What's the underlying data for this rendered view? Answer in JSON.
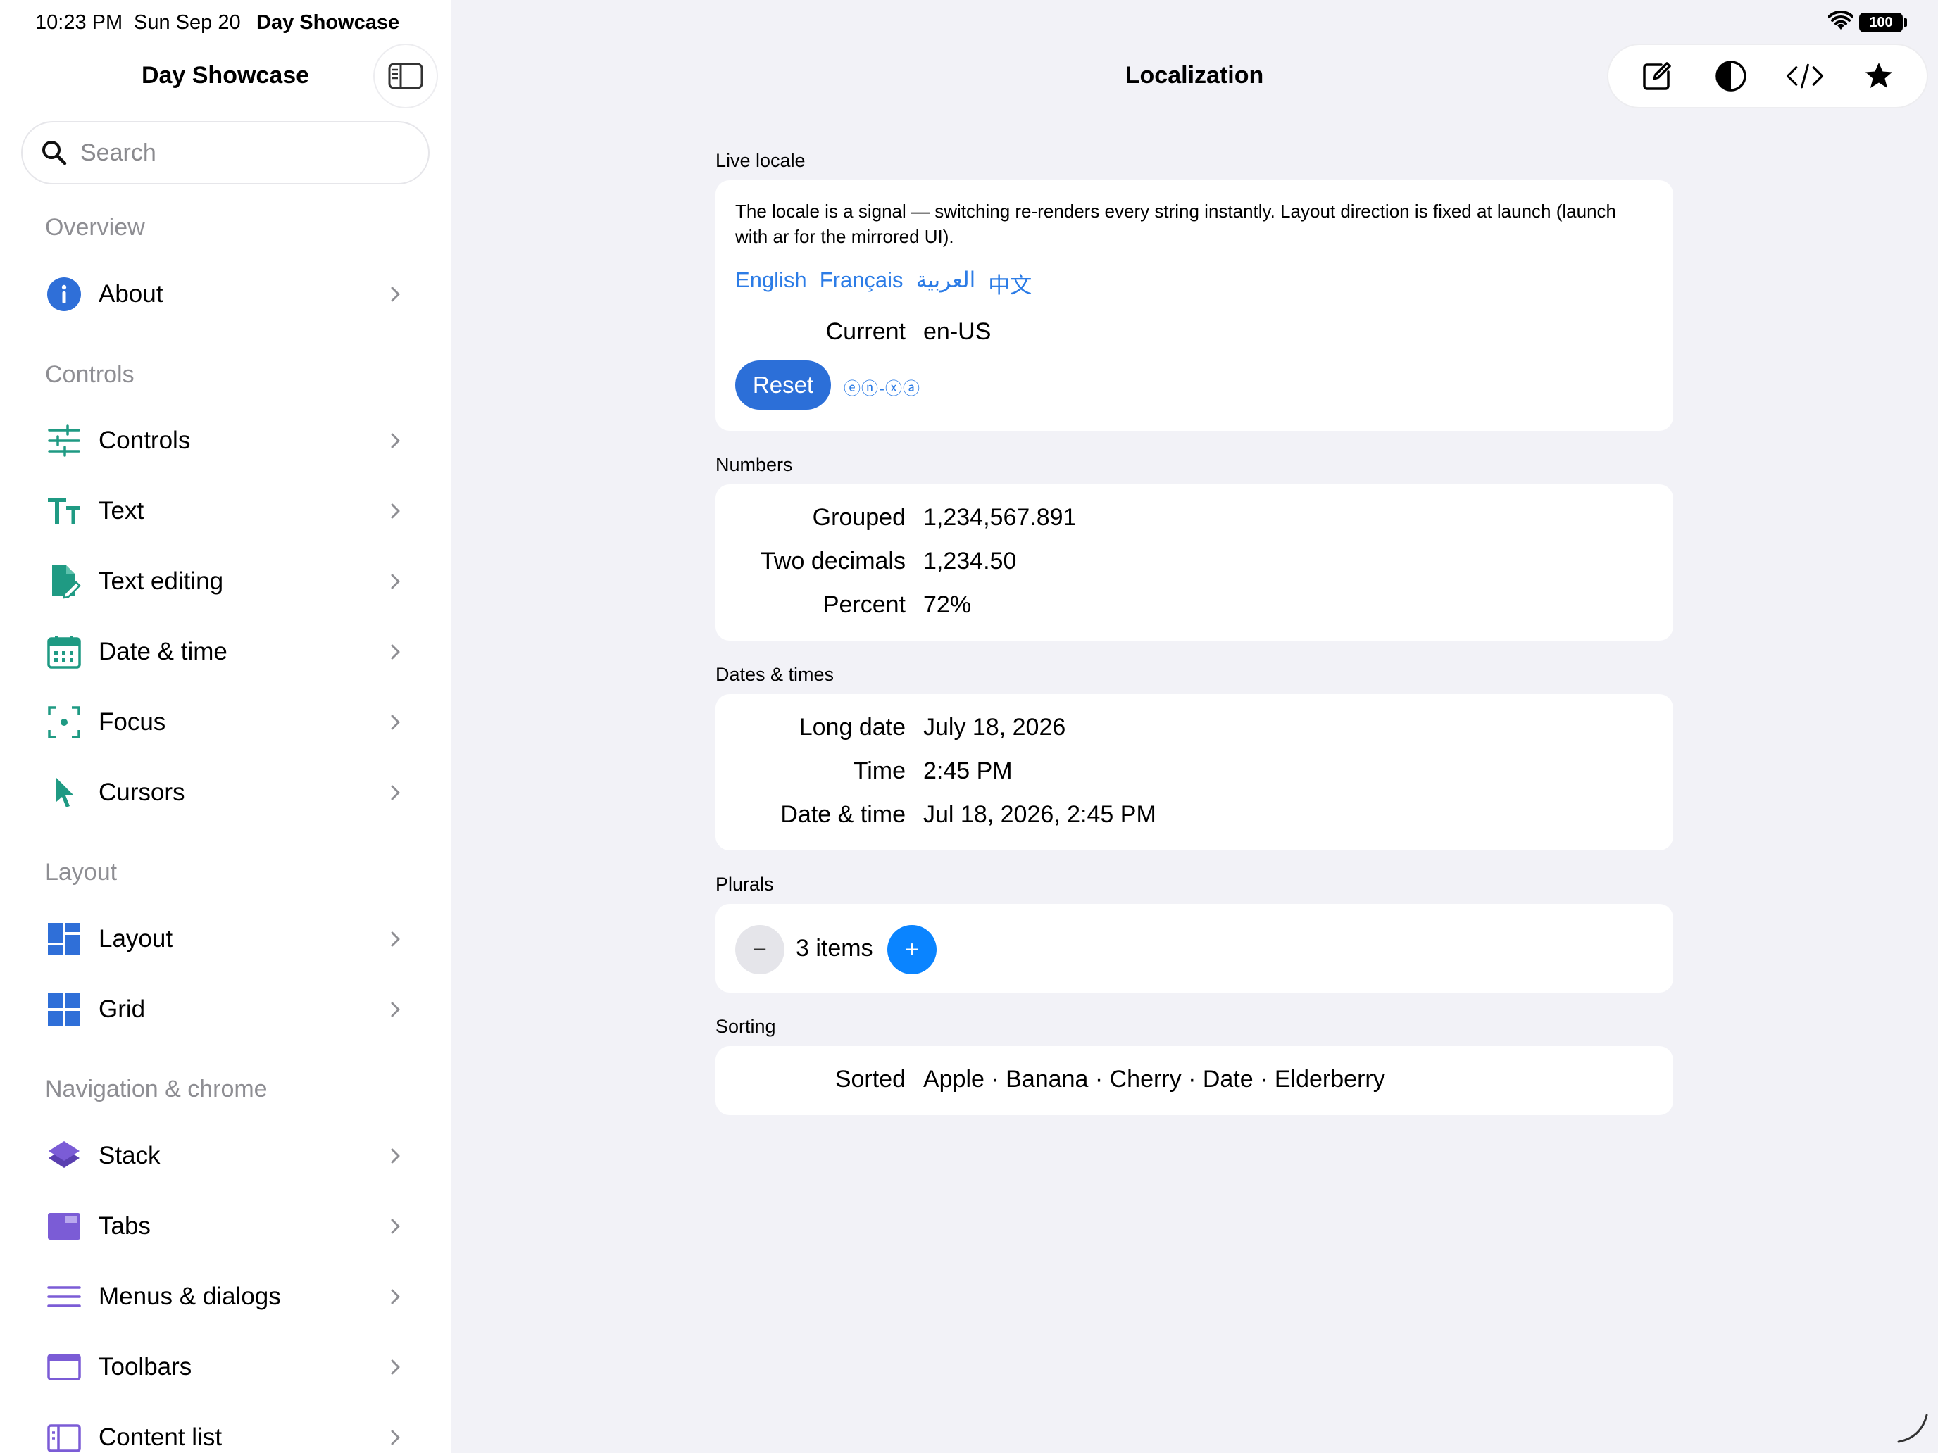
{
  "status_bar": {
    "time": "10:23 PM",
    "date": "Sun Sep 20",
    "app_name": "Day Showcase",
    "battery": "100"
  },
  "sidebar": {
    "title": "Day Showcase",
    "search_placeholder": "Search",
    "sections": {
      "overview": "Overview",
      "controls": "Controls",
      "layout": "Layout",
      "navigation": "Navigation & chrome"
    },
    "items": [
      {
        "label": "About",
        "icon": "info-icon"
      },
      {
        "label": "Controls",
        "icon": "sliders-icon"
      },
      {
        "label": "Text",
        "icon": "text-size-icon"
      },
      {
        "label": "Text editing",
        "icon": "document-edit-icon"
      },
      {
        "label": "Date & time",
        "icon": "calendar-icon"
      },
      {
        "label": "Focus",
        "icon": "focus-icon"
      },
      {
        "label": "Cursors",
        "icon": "cursor-icon"
      },
      {
        "label": "Layout",
        "icon": "layout-icon"
      },
      {
        "label": "Grid",
        "icon": "grid-icon"
      },
      {
        "label": "Stack",
        "icon": "stack-icon"
      },
      {
        "label": "Tabs",
        "icon": "tabs-icon"
      },
      {
        "label": "Menus & dialogs",
        "icon": "menu-icon"
      },
      {
        "label": "Toolbars",
        "icon": "toolbar-icon"
      },
      {
        "label": "Content list",
        "icon": "content-list-icon"
      }
    ]
  },
  "main": {
    "title": "Localization",
    "toolbar": [
      "compose-icon",
      "contrast-icon",
      "code-icon",
      "star-icon"
    ],
    "live_locale": {
      "label": "Live locale",
      "description": "The locale is a signal — switching re-renders every string instantly. Layout direction is fixed at launch (launch with ar for the mirrored UI).",
      "languages": [
        "English",
        "Français",
        "العربية",
        "中文"
      ],
      "current_label": "Current",
      "current_value": "en-US",
      "reset_label": "Reset",
      "reset_caption": "ⓔⓝ-ⓧⓐ"
    },
    "numbers": {
      "label": "Numbers",
      "rows": [
        {
          "label": "Grouped",
          "value": "1,234,567.891"
        },
        {
          "label": "Two decimals",
          "value": "1,234.50"
        },
        {
          "label": "Percent",
          "value": "72%"
        }
      ]
    },
    "dates": {
      "label": "Dates & times",
      "rows": [
        {
          "label": "Long date",
          "value": "July 18, 2026"
        },
        {
          "label": "Time",
          "value": "2:45 PM"
        },
        {
          "label": "Date & time",
          "value": "Jul 18, 2026, 2:45 PM"
        }
      ]
    },
    "plurals": {
      "label": "Plurals",
      "minus": "−",
      "count_text": "3 items",
      "plus": "+"
    },
    "sorting": {
      "label": "Sorting",
      "row_label": "Sorted",
      "value": "Apple · Banana · Cherry · Date · Elderberry"
    }
  },
  "colors": {
    "accent": "#2c7ce6",
    "teal": "#1f9a83",
    "blue": "#2f6fd8",
    "purple": "#7b5cd6",
    "background": "#f2f2f7"
  }
}
